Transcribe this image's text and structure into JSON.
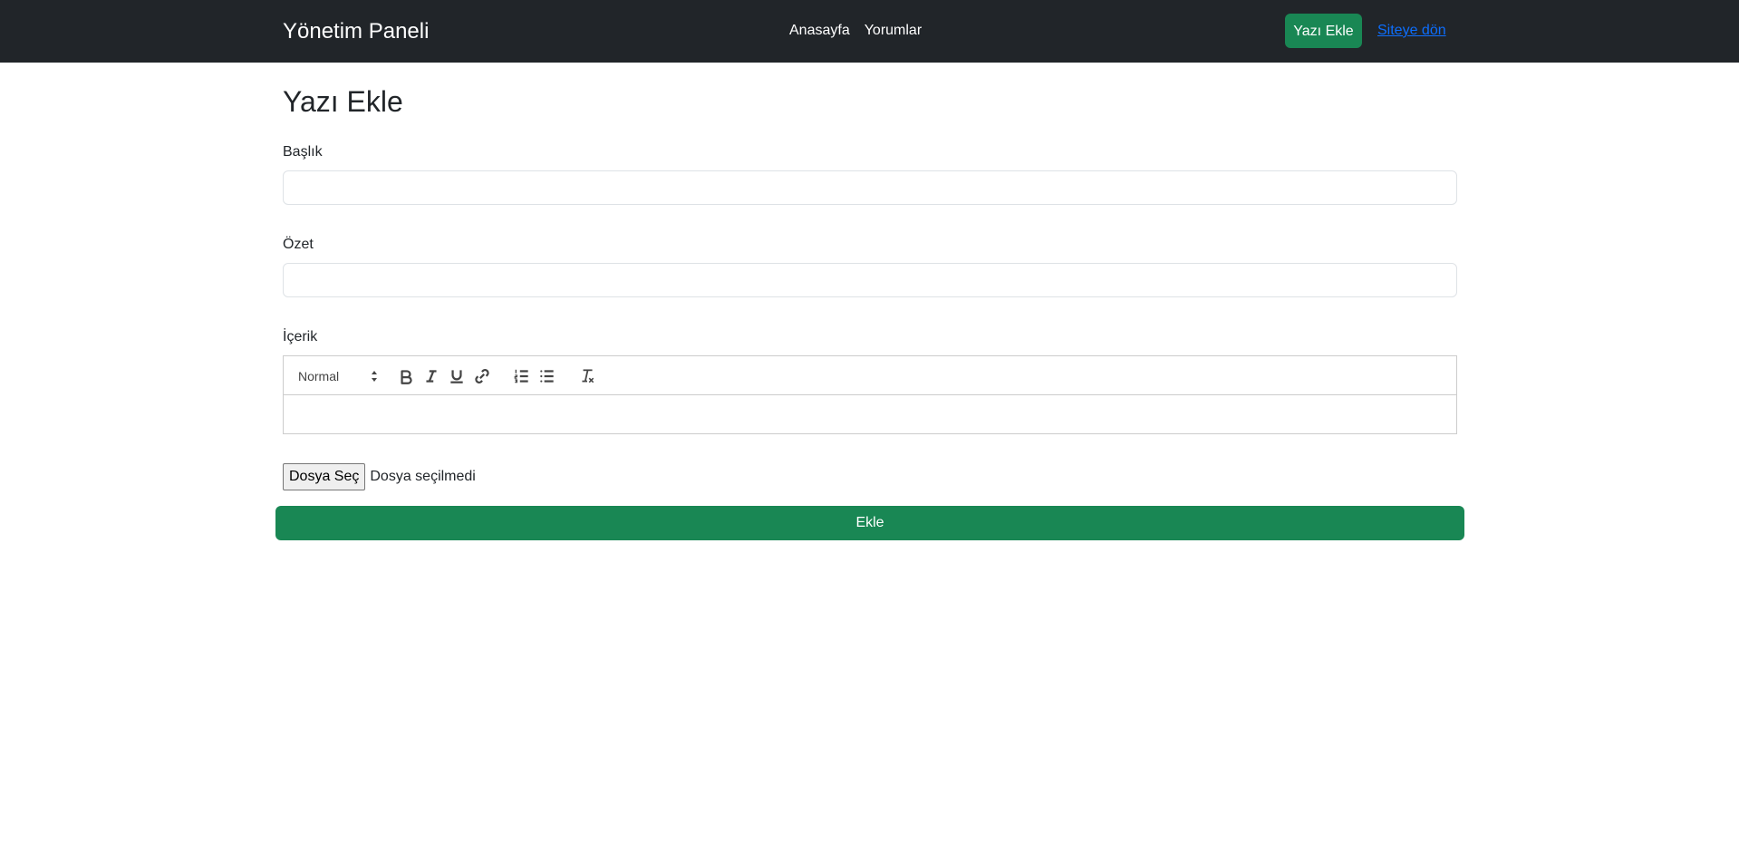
{
  "navbar": {
    "brand": "Yönetim Paneli",
    "links": [
      "Anasayfa",
      "Yorumlar"
    ],
    "add_post_label": "Yazı Ekle",
    "back_to_site_label": "Siteye dön"
  },
  "page": {
    "title": "Yazı Ekle"
  },
  "form": {
    "title_label": "Başlık",
    "title_value": "",
    "summary_label": "Özet",
    "summary_value": "",
    "content_label": "İçerik",
    "editor": {
      "heading_select_value": "Normal",
      "tools": [
        "bold-icon",
        "italic-icon",
        "underline-icon",
        "link-icon",
        "ordered-list-icon",
        "bullet-list-icon",
        "clear-format-icon"
      ]
    },
    "file_button_label": "Dosya Seç",
    "file_status": "Dosya seçilmedi",
    "submit_label": "Ekle"
  },
  "colors": {
    "navbar_bg": "#212529",
    "success": "#198754",
    "link": "#0d6efd"
  }
}
